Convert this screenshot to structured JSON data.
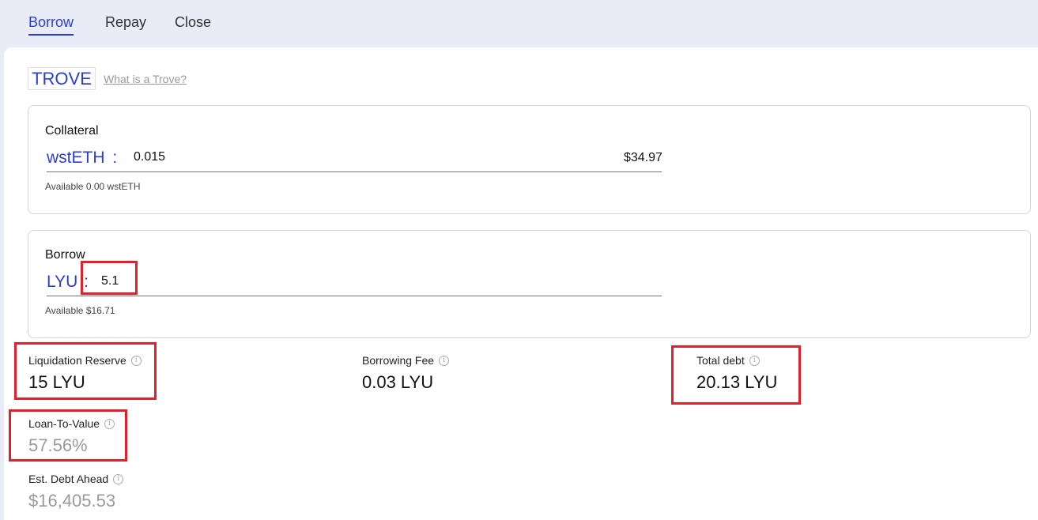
{
  "tabs": [
    {
      "label": "Borrow",
      "active": true
    },
    {
      "label": "Repay",
      "active": false
    },
    {
      "label": "Close",
      "active": false
    }
  ],
  "trove": {
    "badge": "TROVE",
    "help_link": "What is a Trove?"
  },
  "collateral": {
    "label": "Collateral",
    "token": "wstETH",
    "separator": ":",
    "amount": "0.015",
    "usd_value": "$34.97",
    "available": "Available 0.00 wstETH"
  },
  "borrow": {
    "label": "Borrow",
    "token": "LYU",
    "separator": ":",
    "amount": "5.1",
    "available": "Available $16.71"
  },
  "stats": {
    "liquidation_reserve": {
      "label": "Liquidation Reserve",
      "value": "15 LYU"
    },
    "borrowing_fee": {
      "label": "Borrowing Fee",
      "value": "0.03 LYU"
    },
    "total_debt": {
      "label": "Total debt",
      "value": "20.13 LYU"
    },
    "loan_to_value": {
      "label": "Loan-To-Value",
      "value": "57.56%"
    },
    "est_debt_ahead": {
      "label": "Est. Debt Ahead",
      "value": "$16,405.53"
    }
  },
  "colors": {
    "accent": "#2a3fd0",
    "highlight": "#e0202a",
    "muted": "#9a9a9a"
  }
}
